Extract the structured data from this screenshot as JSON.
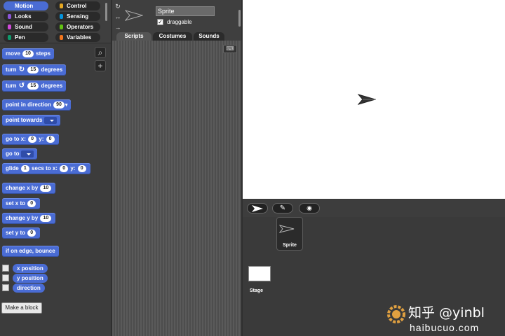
{
  "categories": [
    {
      "label": "Motion",
      "color": "#4a6cd4",
      "active": true
    },
    {
      "label": "Control",
      "color": "#e6a822"
    },
    {
      "label": "Looks",
      "color": "#8a55d7"
    },
    {
      "label": "Sensing",
      "color": "#0494dc"
    },
    {
      "label": "Sound",
      "color": "#cf4ad9"
    },
    {
      "label": "Operators",
      "color": "#62c213"
    },
    {
      "label": "Pen",
      "color": "#0e9a6c"
    },
    {
      "label": "Variables",
      "color": "#f3761d"
    }
  ],
  "blocks": {
    "move": {
      "pre": "move",
      "val": "10",
      "post": "steps"
    },
    "turn_right": {
      "pre": "turn",
      "icon": "↻",
      "val": "15",
      "post": "degrees"
    },
    "turn_left": {
      "pre": "turn",
      "icon": "↺",
      "val": "15",
      "post": "degrees"
    },
    "point_direction": {
      "pre": "point in direction",
      "val": "90"
    },
    "point_towards": {
      "pre": "point towards"
    },
    "goto_xy": {
      "pre": "go to x:",
      "x": "0",
      "mid": "y:",
      "y": "0"
    },
    "goto": {
      "pre": "go to"
    },
    "glide": {
      "pre": "glide",
      "secs": "1",
      "mid1": "secs to x:",
      "x": "0",
      "mid2": "y:",
      "y": "0"
    },
    "change_x": {
      "pre": "change x by",
      "val": "10"
    },
    "set_x": {
      "pre": "set x to",
      "val": "0"
    },
    "change_y": {
      "pre": "change y by",
      "val": "10"
    },
    "set_y": {
      "pre": "set y to",
      "val": "0"
    },
    "bounce": {
      "label": "if on edge, bounce"
    }
  },
  "reporters": [
    "x position",
    "y position",
    "direction"
  ],
  "make_block": "Make a block",
  "sprite": {
    "name": "Sprite",
    "draggable_label": "draggable",
    "draggable_check": "✓"
  },
  "tabs": [
    "Scripts",
    "Costumes",
    "Sounds"
  ],
  "corral": {
    "sprite_label": "Sprite",
    "stage_label": "Stage"
  },
  "watermark": {
    "line1": "知乎 @yinbl",
    "line2": "haibucuo.com"
  }
}
